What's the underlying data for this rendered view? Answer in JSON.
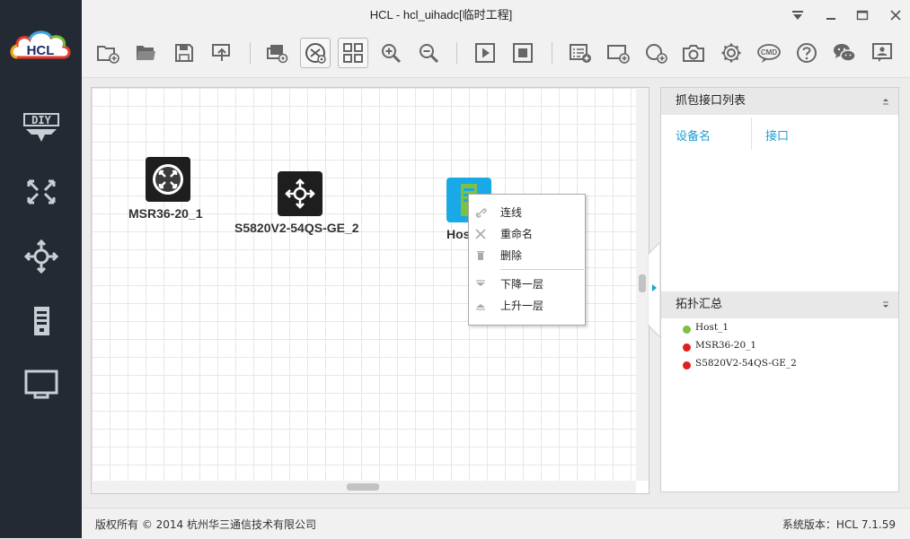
{
  "window": {
    "title": "HCL - hcl_uihadc[临时工程]"
  },
  "sidebar": {
    "logo_text": "HCL",
    "items": [
      {
        "name": "diy-icon",
        "label": "DIY"
      },
      {
        "name": "router-category-icon"
      },
      {
        "name": "switch-category-icon"
      },
      {
        "name": "host-category-icon"
      },
      {
        "name": "cable-category-icon"
      }
    ]
  },
  "toolbar": {
    "buttons": [
      "new-project-icon",
      "open-project-icon",
      "save-icon",
      "export-icon",
      "show-interface-icon",
      "topology-view-icon",
      "grid-view-icon",
      "zoom-in-icon",
      "zoom-out-icon",
      "start-all-icon",
      "stop-all-icon",
      "add-text-icon",
      "add-rectangle-icon",
      "add-ellipse-icon",
      "screenshot-icon",
      "settings-icon",
      "cmd-icon",
      "help-icon",
      "wechat-icon",
      "feedback-icon"
    ],
    "cmd_text": "CMD"
  },
  "canvas": {
    "devices": [
      {
        "label": "MSR36-20_1",
        "type": "router"
      },
      {
        "label": "S5820V2-54QS-GE_2",
        "type": "switch"
      },
      {
        "label": "Hos",
        "type": "host"
      }
    ]
  },
  "context_menu": {
    "items": [
      {
        "label": "连线",
        "icon": "link-icon"
      },
      {
        "label": "重命名",
        "icon": "rename-icon"
      },
      {
        "label": "删除",
        "icon": "delete-icon"
      },
      {
        "label": "下降一层",
        "icon": "layer-down-icon"
      },
      {
        "label": "上升一层",
        "icon": "layer-up-icon"
      }
    ]
  },
  "capture_panel": {
    "title": "抓包接口列表",
    "columns": [
      "设备名",
      "接口"
    ]
  },
  "topology_panel": {
    "title": "拓扑汇总",
    "items": [
      {
        "name": "Host_1",
        "status_color": "#7dc142"
      },
      {
        "name": "MSR36-20_1",
        "status_color": "#e02020"
      },
      {
        "name": "S5820V2-54QS-GE_2",
        "status_color": "#e02020"
      }
    ]
  },
  "status_bar": {
    "copyright": "版权所有 © 2014 杭州华三通信技术有限公司",
    "version": "系统版本：HCL 7.1.59"
  }
}
